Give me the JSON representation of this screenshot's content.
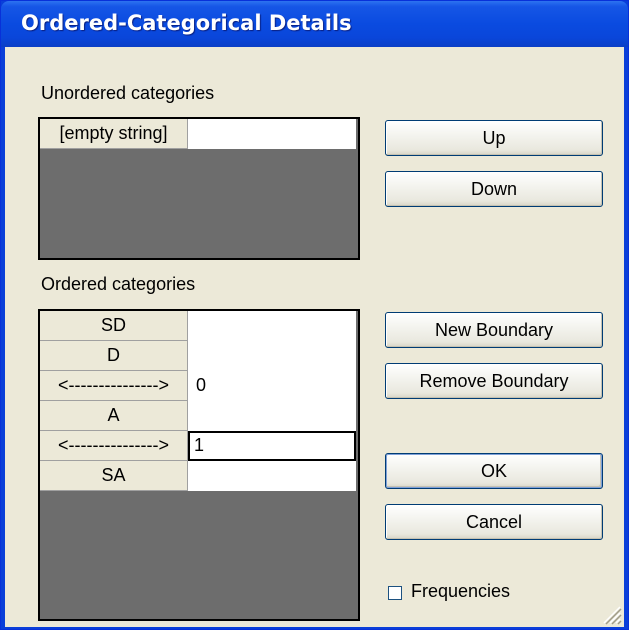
{
  "window": {
    "title": "Ordered-Categorical Details"
  },
  "unordered": {
    "label": "Unordered categories",
    "rows": [
      {
        "name": "[empty string]",
        "value": ""
      }
    ]
  },
  "ordered": {
    "label": "Ordered categories",
    "rows": [
      {
        "name": "SD",
        "value": ""
      },
      {
        "name": "D",
        "value": ""
      },
      {
        "name": "<--------------->",
        "value": "0"
      },
      {
        "name": "A",
        "value": ""
      },
      {
        "name": "<--------------->",
        "value": "1"
      },
      {
        "name": "SA",
        "value": ""
      }
    ]
  },
  "buttons": {
    "up": "Up",
    "down": "Down",
    "new_boundary": "New Boundary",
    "remove_boundary": "Remove Boundary",
    "ok": "OK",
    "cancel": "Cancel"
  },
  "frequencies": {
    "label": "Frequencies",
    "checked": false
  },
  "colors": {
    "title_bar": "#0a4be0",
    "client_bg": "#ece9d8",
    "grid_empty": "#6d6d6d"
  }
}
